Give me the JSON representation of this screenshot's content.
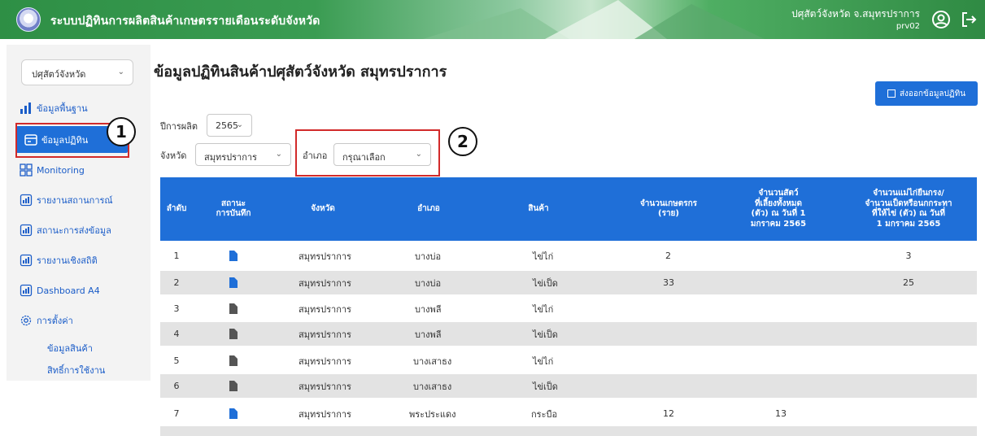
{
  "header": {
    "app_title": "ระบบปฏิทินการผลิตสินค้าเกษตรรายเดือนระดับจังหวัด",
    "user_name": "ปศุสัตว์จังหวัด จ.สมุทรปราการ",
    "user_id": "prv02"
  },
  "sidebar": {
    "department_select": "ปศุสัตว์จังหวัด",
    "items": [
      {
        "label": "ข้อมูลพื้นฐาน",
        "icon": "bar-chart-icon"
      },
      {
        "label": "ข้อมูลปฏิทิน",
        "icon": "calendar-icon",
        "active": true
      },
      {
        "label": "Monitoring",
        "icon": "grid-icon"
      },
      {
        "label": "รายงานสถานการณ์",
        "icon": "report-icon"
      },
      {
        "label": "สถานะการส่งข้อมูล",
        "icon": "report-icon"
      },
      {
        "label": "รายงานเชิงสถิติ",
        "icon": "report-icon"
      },
      {
        "label": "Dashboard A4",
        "icon": "report-icon"
      },
      {
        "label": "การตั้งค่า",
        "icon": "gear-icon"
      }
    ],
    "sub_items": [
      "ข้อมูลสินค้า",
      "สิทธิ์การใช้งาน"
    ]
  },
  "annotations": {
    "one": "1",
    "two": "2"
  },
  "main": {
    "title": "ข้อมูลปฏิทินสินค้าปศุสัตว์จังหวัด สมุทรปราการ",
    "export_button": "ส่งออกข้อมูลปฏิทิน",
    "filters": {
      "year_label": "ปีการผลิต",
      "year_value": "2565",
      "province_label": "จังหวัด",
      "province_value": "สมุทรปราการ",
      "district_label": "อำเภอ",
      "district_value": "กรุณาเลือก"
    }
  },
  "table": {
    "headers": {
      "no": "ลำดับ",
      "status_1": "สถานะ",
      "status_2": "การบันทึก",
      "province": "จังหวัด",
      "district": "อำเภอ",
      "product": "สินค้า",
      "farmers_1": "จำนวนเกษตรกร",
      "farmers_2": "(ราย)",
      "animals_1": "จำนวนสัตว์",
      "animals_2": "ที่เลี้ยงทั้งหมด",
      "animals_3": "(ตัว) ณ วันที่ 1",
      "animals_4": "มกราคม 2565",
      "layers_1": "จำนวนแม่ไก่ยืนกรง/",
      "layers_2": "จำนวนเป็ดหรือนกกระทา",
      "layers_3": "ที่ให้ไข่ (ตัว) ณ วันที่",
      "layers_4": "1 มกราคม 2565"
    },
    "rows": [
      {
        "no": "1",
        "status": "blue",
        "province": "สมุทรปราการ",
        "district": "บางบ่อ",
        "product": "ไข่ไก่",
        "farmers": "2",
        "animals": "",
        "layers": "3"
      },
      {
        "no": "2",
        "status": "blue",
        "province": "สมุทรปราการ",
        "district": "บางบ่อ",
        "product": "ไข่เป็ด",
        "farmers": "33",
        "animals": "",
        "layers": "25"
      },
      {
        "no": "3",
        "status": "gray",
        "province": "สมุทรปราการ",
        "district": "บางพลี",
        "product": "ไข่ไก่",
        "farmers": "",
        "animals": "",
        "layers": ""
      },
      {
        "no": "4",
        "status": "gray",
        "province": "สมุทรปราการ",
        "district": "บางพลี",
        "product": "ไข่เป็ด",
        "farmers": "",
        "animals": "",
        "layers": ""
      },
      {
        "no": "5",
        "status": "gray",
        "province": "สมุทรปราการ",
        "district": "บางเสาธง",
        "product": "ไข่ไก่",
        "farmers": "",
        "animals": "",
        "layers": ""
      },
      {
        "no": "6",
        "status": "gray",
        "province": "สมุทรปราการ",
        "district": "บางเสาธง",
        "product": "ไข่เป็ด",
        "farmers": "",
        "animals": "",
        "layers": ""
      },
      {
        "no": "7",
        "status": "blue",
        "province": "สมุทรปราการ",
        "district": "พระประแดง",
        "product": "กระบือ",
        "farmers": "12",
        "animals": "13",
        "layers": ""
      }
    ]
  }
}
